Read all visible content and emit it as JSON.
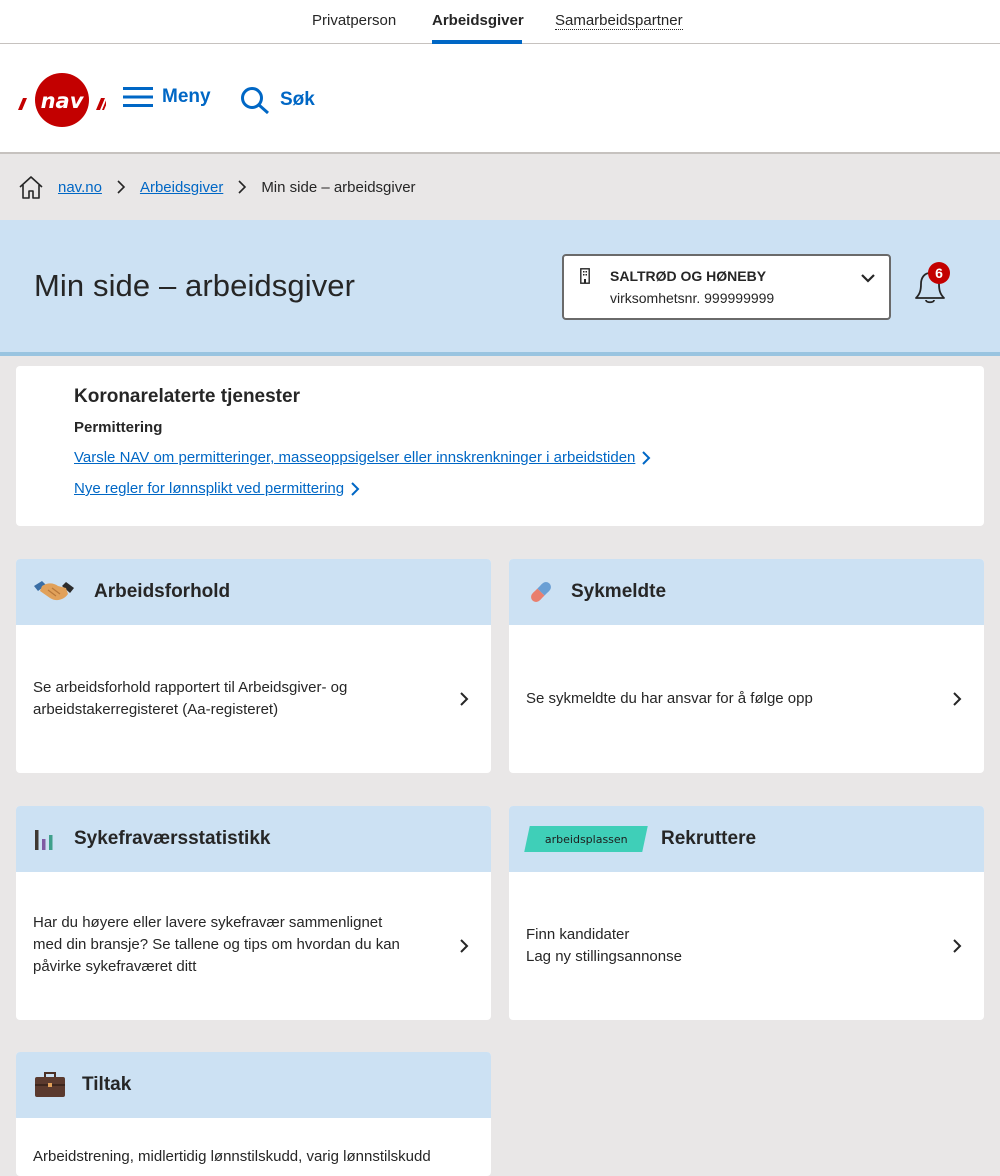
{
  "topnav": {
    "tabs": [
      {
        "label": "Privatperson"
      },
      {
        "label": "Arbeidsgiver"
      },
      {
        "label": "Samarbeidspartner"
      }
    ]
  },
  "header": {
    "menu_label": "Meny",
    "search_label": "Søk",
    "logo_alt": "nav"
  },
  "breadcrumb": {
    "items": [
      "nav.no",
      "Arbeidsgiver",
      "Min side – arbeidsgiver"
    ]
  },
  "banner": {
    "title": "Min side – arbeidsgiver",
    "org_name": "SALTRØD OG HØNEBY",
    "org_number": "virksomhetsnr. 999999999",
    "notification_count": "6"
  },
  "corona": {
    "title": "Koronarelaterte tjenester",
    "subtitle": "Permittering",
    "links": [
      "Varsle NAV om permitteringer, masseoppsigelser eller innskrenkninger i arbeidstiden",
      "Nye regler for lønnsplikt ved permittering"
    ]
  },
  "cards": [
    {
      "title": "Arbeidsforhold",
      "icon": "handshake-icon",
      "text": [
        "Se arbeidsforhold rapportert til Arbeidsgiver- og",
        "arbeidstakerregisteret (Aa-registeret)"
      ]
    },
    {
      "title": "Sykmeldte",
      "icon": "pill-icon",
      "text": [
        "Se sykmeldte du har ansvar for å følge opp"
      ]
    },
    {
      "title": "Sykefraværsstatistikk",
      "icon": "bar-chart-icon",
      "text": [
        "Har du høyere eller lavere sykefravær sammenlignet",
        "med din bransje? Se tallene og tips om hvordan du kan",
        "påvirke sykefraværet ditt"
      ]
    },
    {
      "title": "Rekruttere",
      "icon": "arbeidsplassen-logo",
      "logo_text": "arbeidsplassen",
      "text": [
        "Finn kandidater",
        "Lag ny stillingsannonse"
      ]
    },
    {
      "title": "Tiltak",
      "icon": "briefcase-icon",
      "text": [
        "Arbeidstrening, midlertidig lønnstilskudd, varig lønnstilskudd"
      ]
    }
  ],
  "colors": {
    "brand_red": "#c30000",
    "link_blue": "#0067c5",
    "panel_blue": "#cce1f3",
    "page_bg": "#e9e7e7"
  }
}
